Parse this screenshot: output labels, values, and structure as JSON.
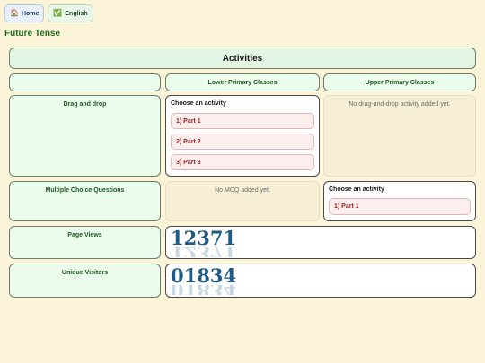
{
  "nav": {
    "home_label": "Home",
    "home_icon": "🏠",
    "english_label": "English",
    "english_icon": "✅"
  },
  "page_title": "Future Tense",
  "activities_title": "Activities",
  "columns": {
    "lower": "Lower Primary Classes",
    "upper": "Upper Primary Classes"
  },
  "rows": {
    "drag_drop": {
      "label": "Drag and drop",
      "lower": {
        "choose": "Choose an activity",
        "parts": [
          "1) Part 1",
          "2) Part 2",
          "3) Part 3"
        ]
      },
      "upper": {
        "empty": "No drag-and-drop activity added yet."
      }
    },
    "mcq": {
      "label": "Multiple Choice Questions",
      "lower": {
        "empty": "No MCQ added yet."
      },
      "upper": {
        "choose": "Choose an activity",
        "parts": [
          "1) Part 1"
        ]
      }
    },
    "page_views": {
      "label": "Page Views",
      "value": "12371"
    },
    "unique_visitors": {
      "label": "Unique Visitors",
      "value": "01834"
    }
  },
  "colors": {
    "background": "#fbf4d9",
    "green_cell": "#ecfcec",
    "title_green": "#236b1f",
    "part_red": "#9a1f1f",
    "counter_blue": "#1e5b86"
  }
}
